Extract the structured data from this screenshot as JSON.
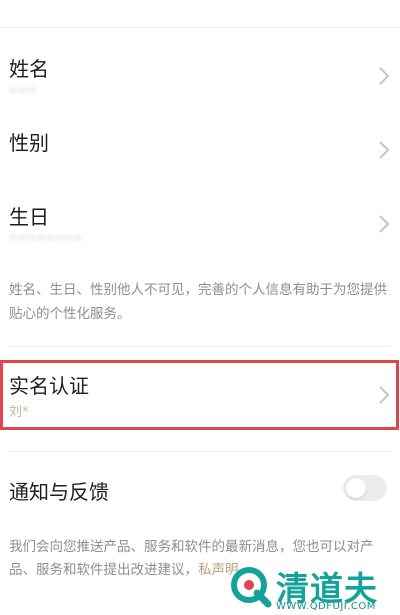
{
  "profile": {
    "name": {
      "label": "姓名",
      "value": "•••"
    },
    "gender": {
      "label": "性别"
    },
    "birthday": {
      "label": "生日",
      "value": "••••••••"
    },
    "hint": "姓名、生日、性别他人不可见，完善的个人信息有助于为您提供贴心的个性化服务。"
  },
  "real_name": {
    "label": "实名认证",
    "value": "刘*"
  },
  "notifications": {
    "label": "通知与反馈",
    "toggle_on": false,
    "notice": "我们会向您推送产品、服务和软件的最新消息，您也可以对产品、服务和软件提出改进建议，",
    "notice_link": "私声明。"
  },
  "watermark": {
    "title": "清道夫",
    "url": "WWW.QDFUJI.COM"
  },
  "colors": {
    "highlight": "#e0454b",
    "accent_link": "#b9a07a",
    "watermark": "#14a39a"
  }
}
